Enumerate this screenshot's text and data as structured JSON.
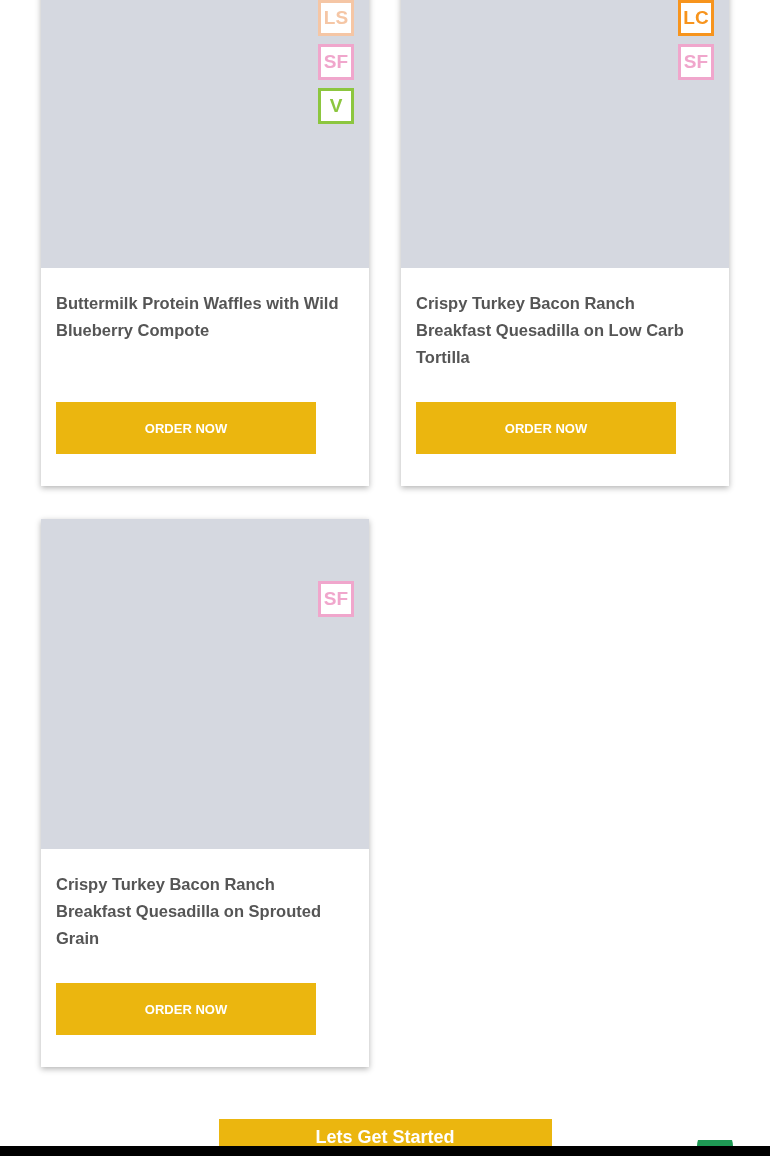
{
  "cards": [
    {
      "title": "Buttermilk Protein Waffles with Wild Blueberry Compote",
      "button": "ORDER NOW",
      "badges": [
        {
          "label": "LS",
          "color": "#f5c6a5"
        },
        {
          "label": "SF",
          "color": "#f0a6cc"
        },
        {
          "label": "V",
          "color": "#8cc63f"
        }
      ]
    },
    {
      "title": "Crispy Turkey Bacon Ranch Breakfast Quesadilla on Low Carb Tortilla",
      "button": "ORDER NOW",
      "badges": [
        {
          "label": "LC",
          "color": "#f7941d"
        },
        {
          "label": "SF",
          "color": "#f0a6cc"
        }
      ]
    },
    {
      "title": "Crispy Turkey Bacon Ranch Breakfast Quesadilla on Sprouted Grain",
      "button": "ORDER NOW",
      "badges": [
        {
          "label": "SF",
          "color": "#f0a6cc"
        }
      ]
    }
  ],
  "cta": "Lets Get Started"
}
